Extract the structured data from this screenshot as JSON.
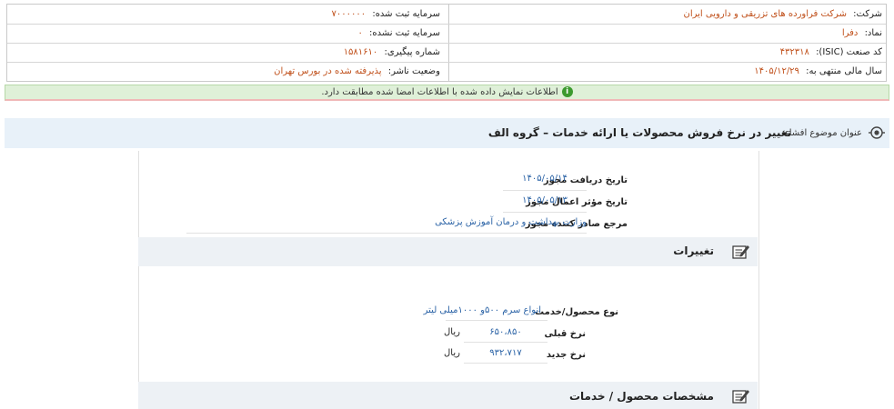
{
  "header": {
    "company_label": "شرکت:",
    "company_value": "شرکت فراورده های تزریقی و دارویی ایران",
    "symbol_label": "نماد:",
    "symbol_value": "دفرا",
    "isic_label": "کد صنعت (ISIC):",
    "isic_value": "۴۳۲۳۱۸",
    "fiscal_label": "سال مالی منتهی به:",
    "fiscal_value": "۱۴۰۵/۱۲/۲۹",
    "reg_capital_label": "سرمایه ثبت شده:",
    "reg_capital_value": "۷۰۰۰۰۰۰",
    "unreg_capital_label": "سرمایه ثبت نشده:",
    "unreg_capital_value": "۰",
    "tracking_label": "شماره پیگیری:",
    "tracking_value": "۱۵۸۱۶۱۰",
    "status_label": "وضعیت ناشر:",
    "status_value": "پذیرفته شده در بورس تهران"
  },
  "notice": {
    "icon": "info-icon",
    "text": "اطلاعات نمایش داده شده با اطلاعات امضا شده مطابقت دارد."
  },
  "subject": {
    "label": "عنوان موضوع افشاء:",
    "value": "تغییر در نرخ فروش محصولات یا ارائه خدمات – گروه الف"
  },
  "permit": {
    "received_label": "تاریخ دریافت مجوز",
    "received_value": "۱۴۰۵/۰۵/۱۴",
    "effective_label": "تاریخ مؤثر اعمال مجوز",
    "effective_value": "۱۴۰۵/۰۵/۱۳",
    "issuer_label": "مرجع صادر کننده مجوز",
    "issuer_value": "وزارت بهداشت و درمان آموزش پزشکی"
  },
  "changes": {
    "title": "تغییرات",
    "type_label": "نوع محصول/خدمت",
    "type_value": "انواع سرم ۵۰۰و ۱۰۰۰میلی لیتر",
    "old_label": "نرخ قبلی",
    "old_value": "۶۵۰،۸۵۰",
    "old_unit": "ریال",
    "new_label": "نرخ جدید",
    "new_value": "۹۳۲،۷۱۷",
    "new_unit": "ریال"
  },
  "specs": {
    "title": "مشخصات محصول / خدمات"
  }
}
